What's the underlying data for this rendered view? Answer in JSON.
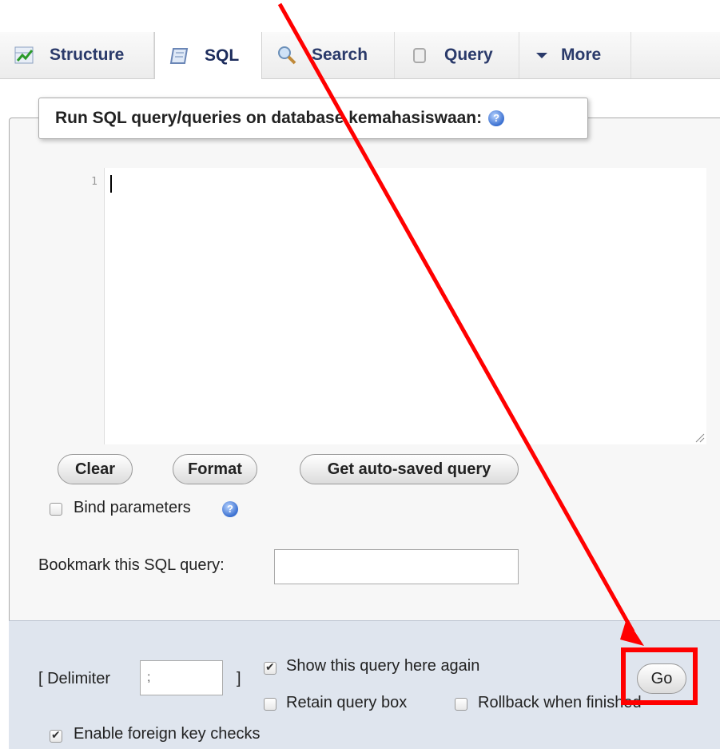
{
  "tabs": [
    {
      "label": "Structure",
      "icon": "structure-icon"
    },
    {
      "label": "SQL",
      "icon": "sql-icon",
      "active": true
    },
    {
      "label": "Search",
      "icon": "search-icon"
    },
    {
      "label": "Query",
      "icon": "query-icon"
    },
    {
      "label": "More",
      "icon": "caret-down-icon"
    }
  ],
  "panel": {
    "legend": "Run SQL query/queries on database kemahasiswaan:",
    "editor_line_number": "1",
    "buttons": {
      "clear": "Clear",
      "format": "Format",
      "autosaved": "Get auto-saved query"
    },
    "bind_parameters": {
      "label": "Bind parameters",
      "checked": false
    },
    "bookmark_label": "Bookmark this SQL query:",
    "bookmark_value": ""
  },
  "footer": {
    "delimiter_label": "[ Delimiter",
    "delimiter_close": "]",
    "delimiter_value": ";",
    "show_query_again": {
      "label": "Show this query here again",
      "checked": true
    },
    "retain_query_box": {
      "label": "Retain query box",
      "checked": false
    },
    "rollback": {
      "label": "Rollback when finished",
      "checked": false
    },
    "foreign_keys": {
      "label": "Enable foreign key checks",
      "checked": true
    },
    "go_label": "Go"
  },
  "colors": {
    "annotation": "#ff0000",
    "tab_text": "#2a3a6a",
    "footer_bg": "#dfe5ee"
  }
}
